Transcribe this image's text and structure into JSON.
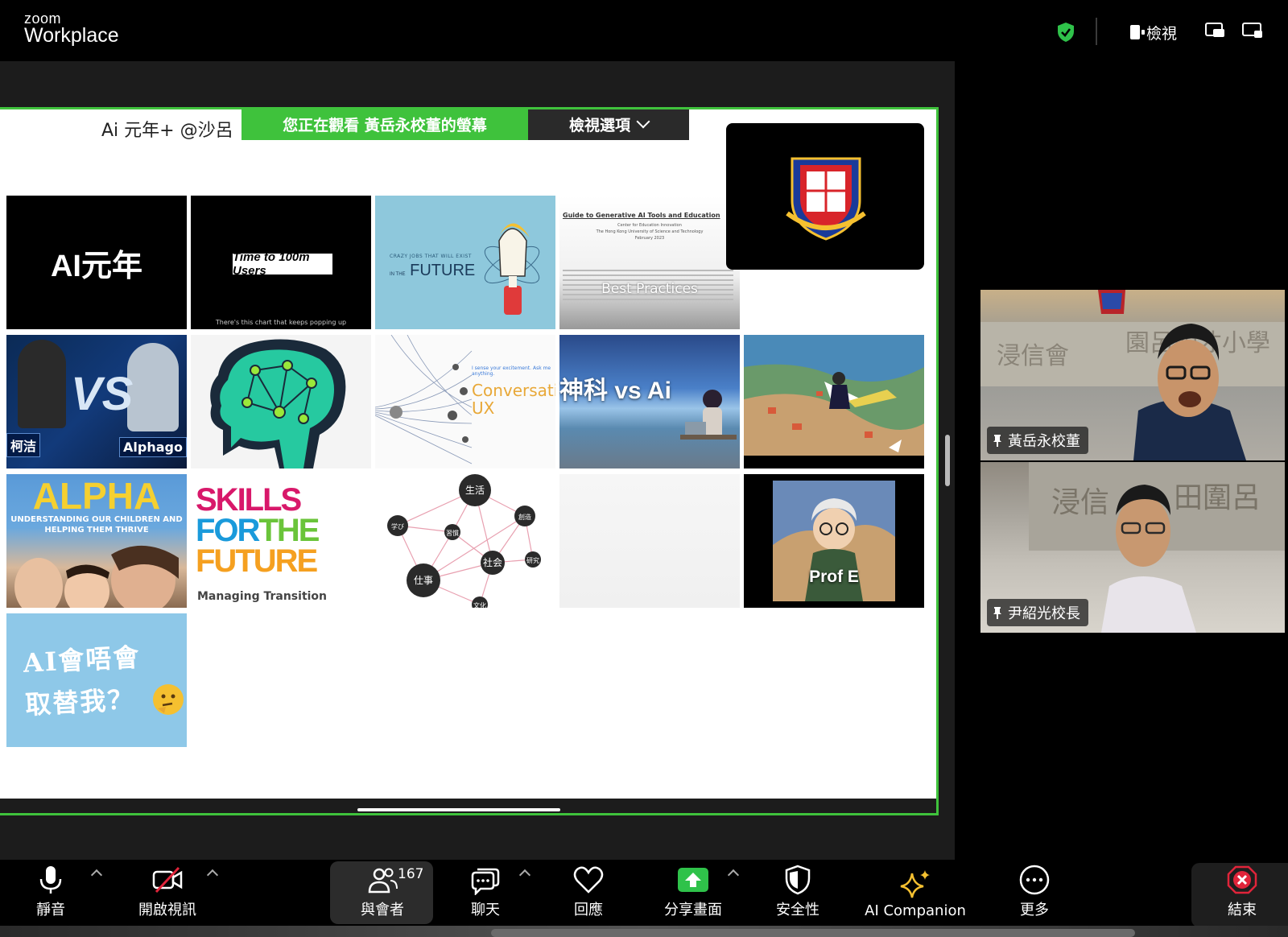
{
  "app": {
    "logo_small": "zoom",
    "logo_big": "Workplace",
    "view_label": "檢視"
  },
  "share": {
    "slide_title": "Ai 元年+  @沙呂",
    "banner_text": "您正在觀看 黃岳永校董的螢幕",
    "view_options_label": "檢視選項"
  },
  "thumbnails": {
    "ai_yuannian": "AI元年",
    "time_to_100m": "Time to 100m Users",
    "time_to_100m_sub": "There's this chart that keeps popping up",
    "future_small": "CRAZY JOBS THAT WILL EXIST",
    "future_in_the": "IN THE",
    "future_big": "FUTURE",
    "guide_title": "Guide to Generative AI Tools and Education",
    "guide_org": "Center for Education Innovation",
    "guide_univ": "The Hong Kong University of Science and Technology",
    "guide_date": "February 2023",
    "guide_best": "Best Practices",
    "vs_left": "柯洁",
    "vs_right": "Alphago",
    "vs_mid": "VS",
    "ux_small": "I sense your excitement. Ask me anything.",
    "ux_text": "Conversational UX",
    "shenke": "神科 vs Ai",
    "alpha_big": "ALPHA",
    "alpha_sub": "UNDERSTANDING OUR CHILDREN AND HELPING THEM THRIVE",
    "skills_1": "SKILLS",
    "skills_2a": "FOR",
    "skills_2b": "THE",
    "skills_3": "FUTURE",
    "skills_sub": "Managing Transition",
    "net_nodes": [
      "生活",
      "創造",
      "学び",
      "習慣",
      "社会",
      "研究",
      "仕事",
      "文化"
    ],
    "profe": "Prof E",
    "aihui_line1": "AI會唔會",
    "aihui_line2": "取替我？"
  },
  "participants": [
    {
      "name": "黃岳永校董"
    },
    {
      "name": "尹紹光校長"
    }
  ],
  "toolbar": {
    "mute": "靜音",
    "video": "開啟視訊",
    "participants": "與會者",
    "participant_count": "167",
    "chat": "聊天",
    "reactions": "回應",
    "share": "分享畫面",
    "security": "安全性",
    "ai_companion": "AI Companion",
    "more": "更多",
    "end": "結束"
  },
  "colors": {
    "share_border": "#3fc23c",
    "end_red": "#e0243a",
    "share_green": "#2fc24a",
    "ai_gold": "#f5c030"
  }
}
